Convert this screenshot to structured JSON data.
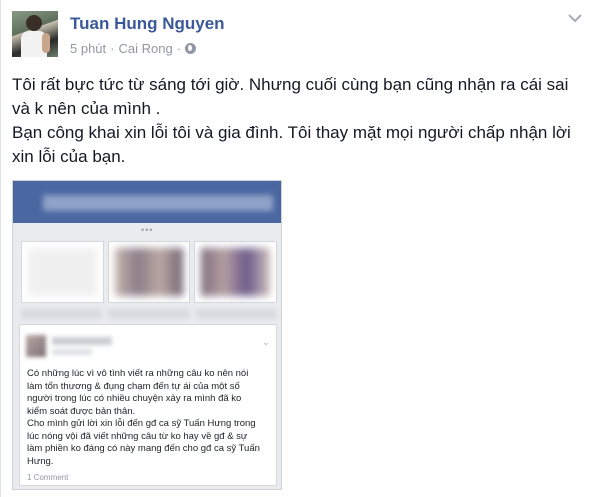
{
  "post": {
    "author": "Tuan Hung Nguyen",
    "time": "5 phút",
    "separator": "·",
    "location": "Cai Rong",
    "separator2": "·",
    "text_lines": [
      "Tôi rất bực tức từ sáng tới giờ. Nhưng cuối cùng bạn cũng nhận ra cái sai",
      "và k nên của mình .",
      "Bạn công khai xin lỗi tôi và gia đình. Tôi thay mặt mọi người chấp nhận lời",
      "xin lỗi của bạn."
    ]
  },
  "screenshot": {
    "dots": "•••",
    "chevron": "⌄",
    "text": "Có những lúc vì vô tình viết ra những câu ko nên nói\nlàm tổn thương & đụng chạm đến tự ái của một số\nngười trong lúc có nhiều chuyện xảy ra mình đã ko\nkiểm soát được bản thân.\nCho mình gửi lời xin lỗi đến gđ ca sỹ Tuấn Hưng trong\nlúc nóng vội đã viết những câu từ ko hay về gđ & sự\nlàm phiền ko đáng có này mang đến cho gđ ca sỹ Tuấn\nHưng.",
    "comments": "1 Comment"
  },
  "icons": {
    "globe": "globe-icon",
    "chevron": "chevron-down-icon"
  },
  "colors": {
    "author": "#3b5998",
    "meta": "#9197a3",
    "text": "#141823"
  }
}
